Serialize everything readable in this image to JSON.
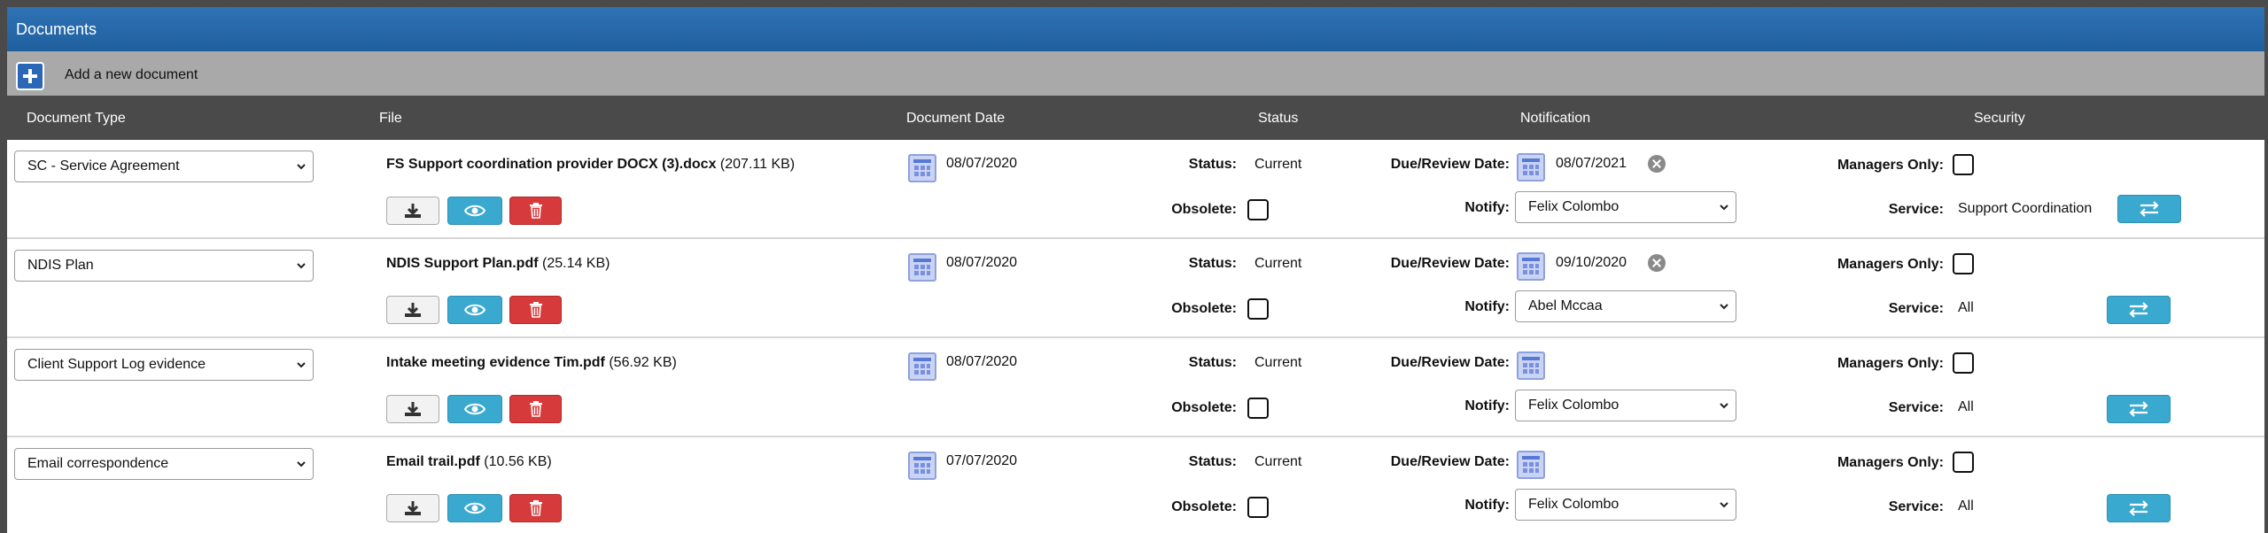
{
  "panel": {
    "title": "Documents",
    "add_label": "Add a new document"
  },
  "columns": {
    "document_type": "Document Type",
    "file": "File",
    "document_date": "Document Date",
    "status": "Status",
    "notification": "Notification",
    "security": "Security"
  },
  "labels": {
    "status": "Status:",
    "obsolete": "Obsolete:",
    "due_review_date": "Due/Review Date:",
    "notify": "Notify:",
    "managers_only": "Managers Only:",
    "service": "Service:"
  },
  "rows": [
    {
      "doc_type": "SC - Service Agreement",
      "file_name": "FS Support coordination provider DOCX (3).docx",
      "file_size": " (207.11 KB)",
      "document_date": "08/07/2020",
      "status": "Current",
      "due_date": "08/07/2021",
      "notify": "Felix Colombo",
      "service": "Support Coordination"
    },
    {
      "doc_type": "NDIS Plan",
      "file_name": "NDIS Support Plan.pdf",
      "file_size": " (25.14 KB)",
      "document_date": "08/07/2020",
      "status": "Current",
      "due_date": "09/10/2020",
      "notify": "Abel Mccaa",
      "service": "All"
    },
    {
      "doc_type": "Client Support Log evidence",
      "file_name": "Intake meeting evidence Tim.pdf",
      "file_size": " (56.92 KB)",
      "document_date": "08/07/2020",
      "status": "Current",
      "due_date": "",
      "notify": "Felix Colombo",
      "service": "All"
    },
    {
      "doc_type": "Email correspondence",
      "file_name": "Email trail.pdf",
      "file_size": " (10.56 KB)",
      "document_date": "07/07/2020",
      "status": "Current",
      "due_date": "",
      "notify": "Felix Colombo",
      "service": "All"
    }
  ],
  "colors": {
    "title_bar": "#2f73b5",
    "add_bar": "#a9a9a9",
    "header_bar": "#4a4a4a",
    "view_button": "#39a9cf",
    "delete_button": "#d73a3a"
  }
}
